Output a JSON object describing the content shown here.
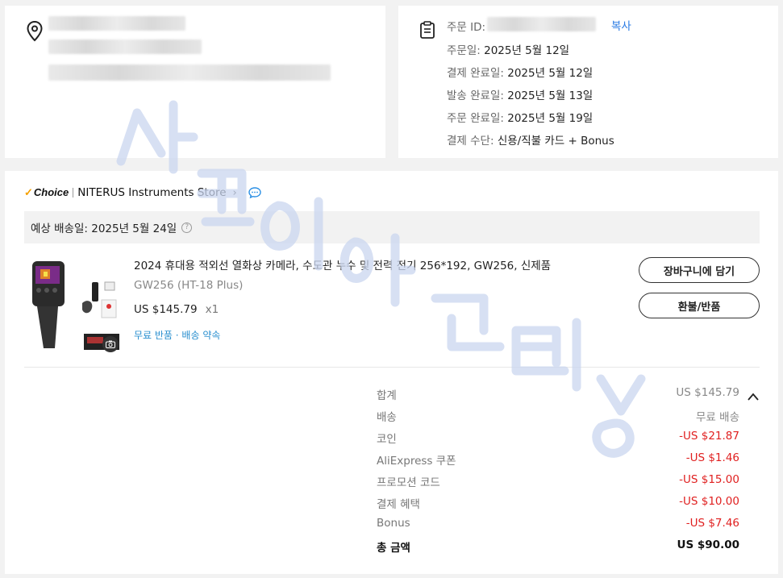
{
  "order": {
    "id_label": "주문 ID:",
    "copy_label": "복사",
    "lines": [
      {
        "key": "주문일:",
        "value": "2025년 5월 12일"
      },
      {
        "key": "결제 완료일:",
        "value": "2025년 5월 12일"
      },
      {
        "key": "발송 완료일:",
        "value": "2025년 5월 13일"
      },
      {
        "key": "주문 완료일:",
        "value": "2025년 5월 19일"
      },
      {
        "key": "결제 수단:",
        "value": "신용/직불 카드 + Bonus"
      }
    ]
  },
  "store": {
    "choice_label": "Choice",
    "name": "NITERUS Instruments Store",
    "eta": "예상 배송일: 2025년 5월 24일"
  },
  "product": {
    "title": "2024 휴대용 적외선 열화상 카메라, 수도관 누수 및 전력 전기 256*192, GW256, 신제품",
    "variant": "GW256 (HT-18 Plus)",
    "price": "US $145.79",
    "qty": "x1",
    "perks": "무료 반품 · 배송 약속"
  },
  "actions": {
    "cart": "장바구니에 담기",
    "refund": "환불/반품"
  },
  "summary": {
    "rows": [
      {
        "label": "합계",
        "value": "US $145.79",
        "accent": "#888888"
      },
      {
        "label": "배송",
        "value": "무료 배송",
        "accent": "#888888"
      },
      {
        "label": "코인",
        "value": "-US $21.87",
        "accent": "#e02020"
      },
      {
        "label": "AliExpress 쿠폰",
        "value": "-US $1.46",
        "accent": "#e02020"
      },
      {
        "label": "프로모션 코드",
        "value": "-US $15.00",
        "accent": "#e02020"
      },
      {
        "label": "결제 혜택",
        "value": "-US $10.00",
        "accent": "#e02020"
      },
      {
        "label": "Bonus",
        "value": "-US $7.46",
        "accent": "#e02020"
      }
    ],
    "total_label": "총 금액",
    "total_value": "US $90.00"
  },
  "icons": {
    "location": "location-pin-icon",
    "clipboard": "clipboard-icon",
    "chat": "chat-bubble-icon",
    "help": "question-mark-icon",
    "camera": "camera-icon",
    "collapse": "chevron-up-icon"
  },
  "colors": {
    "link_blue": "#2a7be4",
    "discount_red": "#e02020",
    "choice_orange": "#f5a000"
  }
}
